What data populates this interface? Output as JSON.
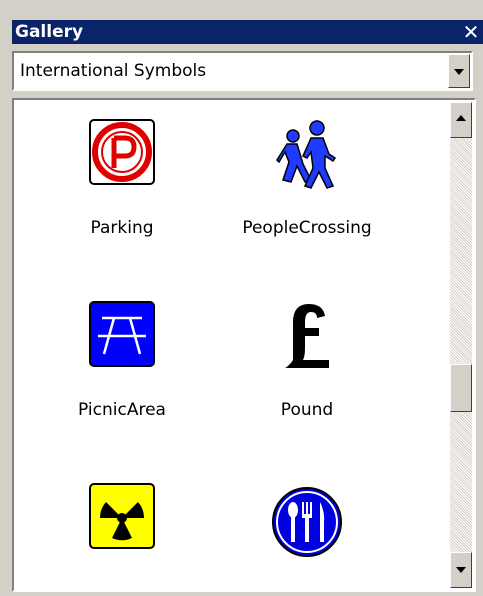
{
  "window": {
    "title": "Gallery",
    "close_glyph": "✕"
  },
  "category": {
    "selected": "International Symbols"
  },
  "items": [
    {
      "label": "Parking",
      "icon": "parking-icon"
    },
    {
      "label": "PeopleCrossing",
      "icon": "people-crossing-icon"
    },
    {
      "label": "PicnicArea",
      "icon": "picnic-area-icon"
    },
    {
      "label": "Pound",
      "icon": "pound-icon"
    },
    {
      "label": "",
      "icon": "radioactive-icon"
    },
    {
      "label": "",
      "icon": "restaurant-icon"
    }
  ],
  "colors": {
    "titlebar": "#0a246a",
    "face": "#d4d0c8",
    "parking_red": "#e00000",
    "picnic_blue": "#0000ff",
    "people_blue": "#1f3bff",
    "radiation_yellow": "#ffff00",
    "restaurant_blue": "#0000e0"
  },
  "scroll": {
    "position_fraction": 0.6
  }
}
